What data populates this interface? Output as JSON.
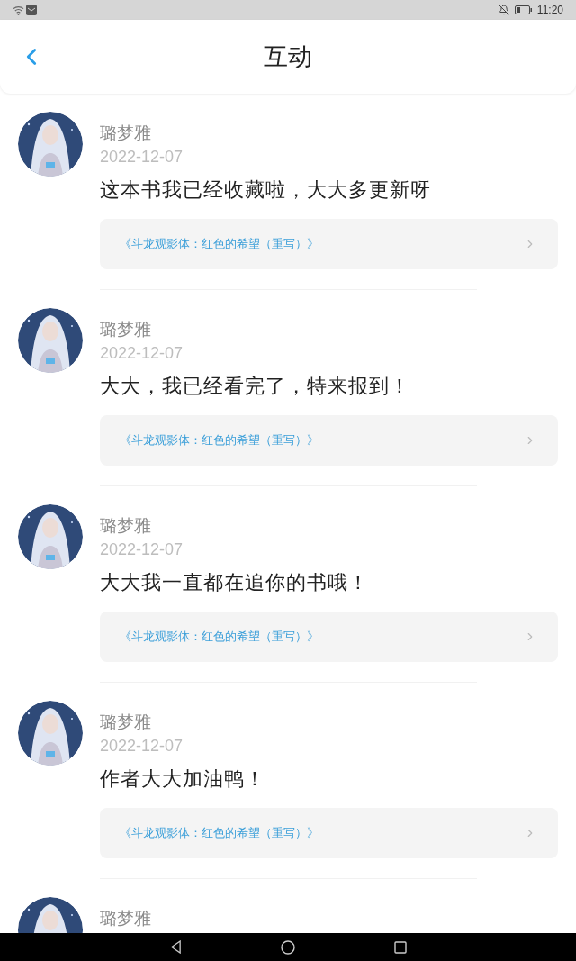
{
  "status_bar": {
    "time": "11:20"
  },
  "header": {
    "title": "互动"
  },
  "comments": [
    {
      "author": "璐梦雅",
      "date": "2022-12-07",
      "text": "这本书我已经收藏啦，大大多更新呀",
      "book": "《斗龙观影体：红色的希望（重写）》"
    },
    {
      "author": "璐梦雅",
      "date": "2022-12-07",
      "text": "大大，我已经看完了，特来报到！",
      "book": "《斗龙观影体：红色的希望（重写）》"
    },
    {
      "author": "璐梦雅",
      "date": "2022-12-07",
      "text": "大大我一直都在追你的书哦！",
      "book": "《斗龙观影体：红色的希望（重写）》"
    },
    {
      "author": "璐梦雅",
      "date": "2022-12-07",
      "text": "作者大大加油鸭！",
      "book": "《斗龙观影体：红色的希望（重写）》"
    }
  ],
  "partial_comment": {
    "author": "璐梦雅"
  }
}
